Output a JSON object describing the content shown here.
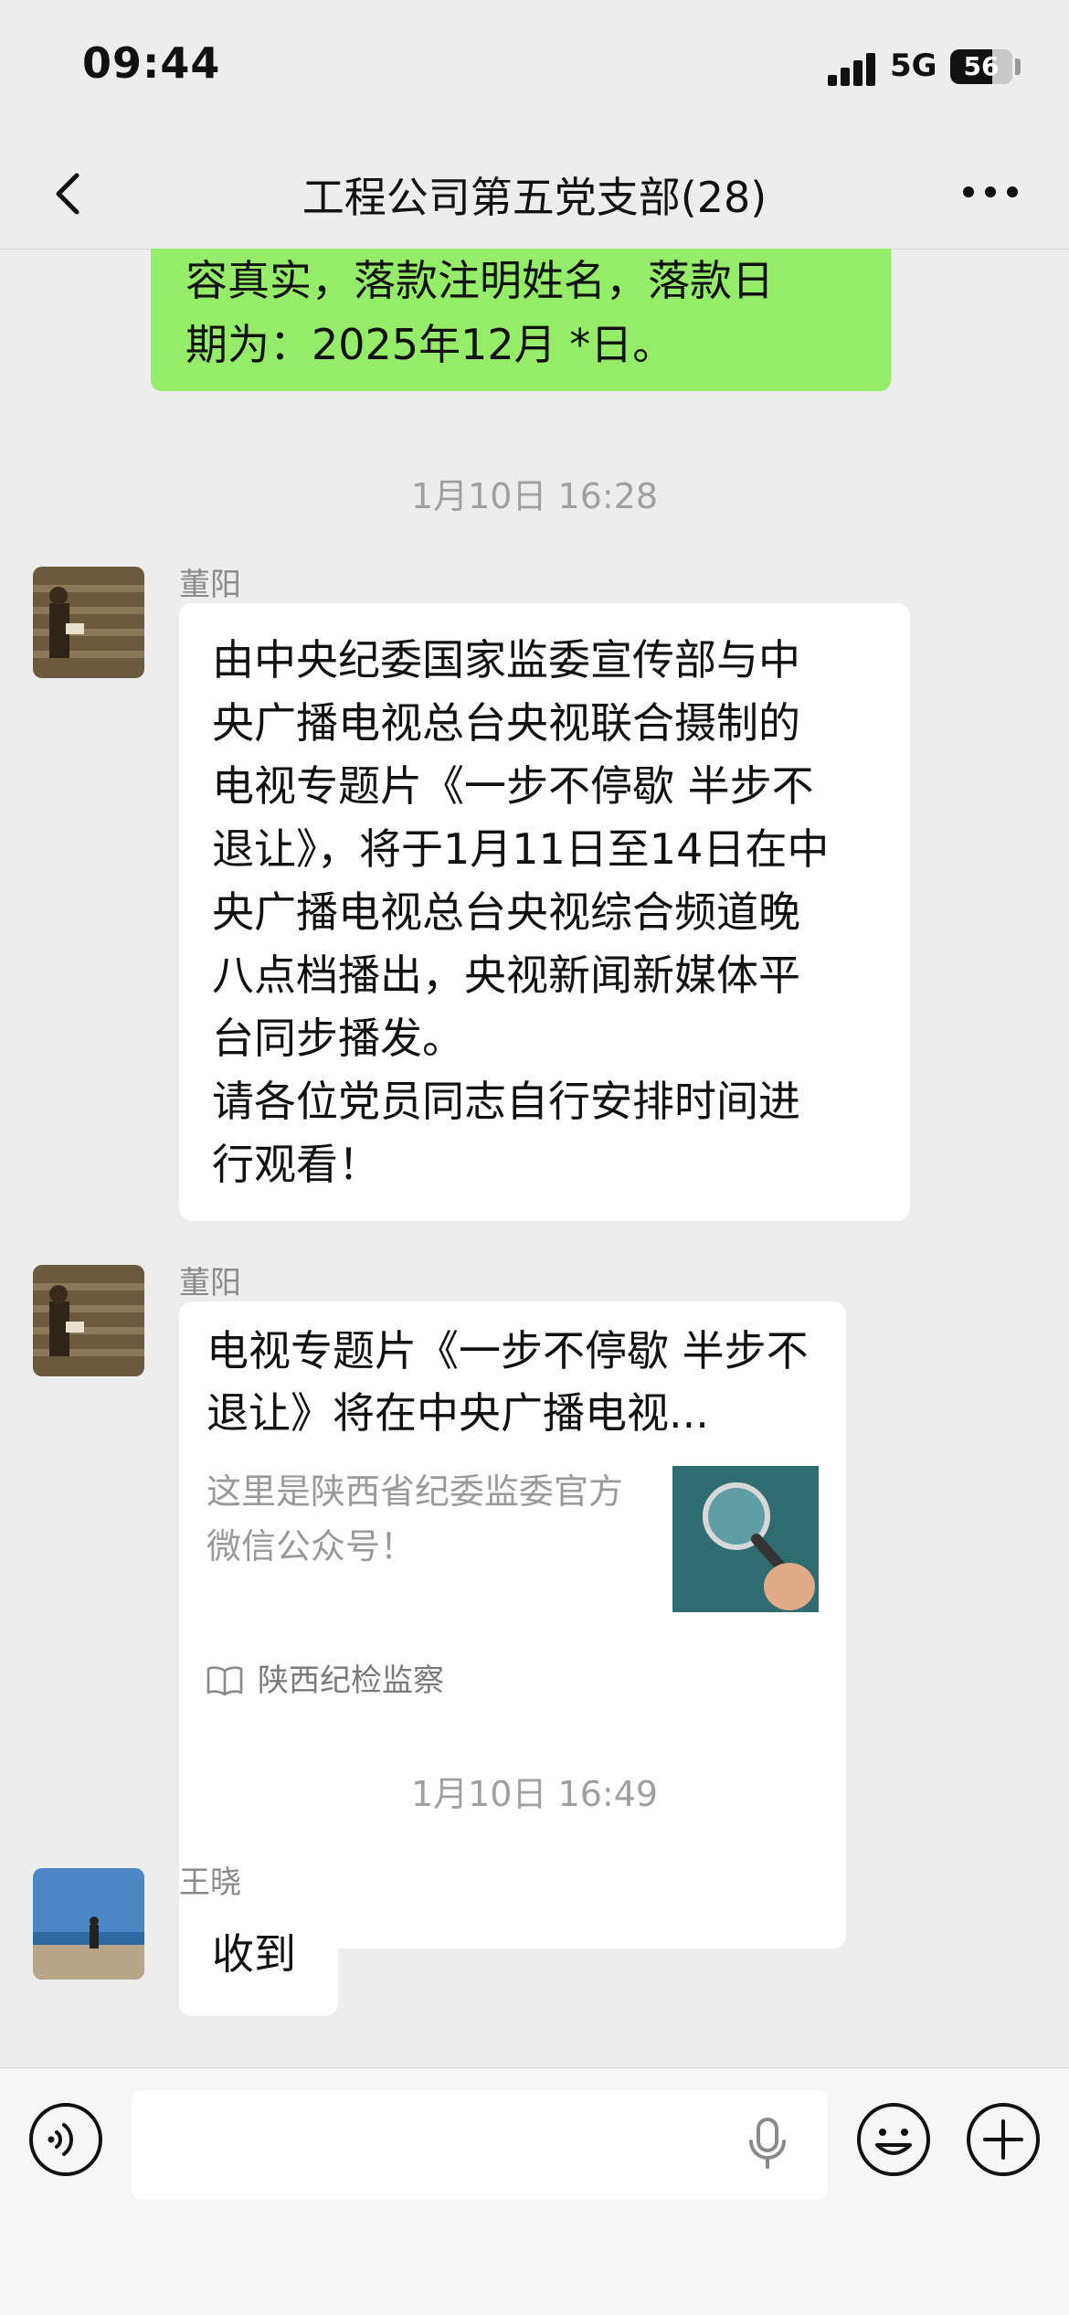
{
  "status_bar": {
    "time": "09:44",
    "network": "5G",
    "battery": "56"
  },
  "nav": {
    "title": "工程公司第五党支部(28)"
  },
  "messages": {
    "self_partial": {
      "lines": [
        "容真实，落款注明姓名，落款日",
        "期为：2025年12月 *日。"
      ]
    },
    "timestamp_1": "1月10日 16:28",
    "msg1": {
      "sender": "董阳",
      "lines": [
        "由中央纪委国家监委宣传部与中",
        "央广播电视总台央视联合摄制的",
        "电视专题片《一步不停歇 半步不",
        "退让》，将于1月11日至14日在中",
        "央广播电视总台央视综合频道晚",
        "八点档播出，央视新闻新媒体平",
        "台同步播发。",
        "请各位党员同志自行安排时间进",
        "行观看！"
      ]
    },
    "msg2": {
      "sender": "董阳",
      "card_title": "电视专题片《一步不停歇 半步不退让》将在中央广播电视...",
      "card_desc": "这里是陕西省纪委监委官方微信公众号！",
      "card_source": "陕西纪检监察"
    },
    "timestamp_2": "1月10日 16:49",
    "msg3": {
      "sender": "王晓",
      "text": "收到"
    }
  },
  "input_bar": {
    "placeholder": ""
  },
  "colors": {
    "self_bubble": "#95ec69",
    "background": "#ededed",
    "bubble": "#ffffff"
  }
}
